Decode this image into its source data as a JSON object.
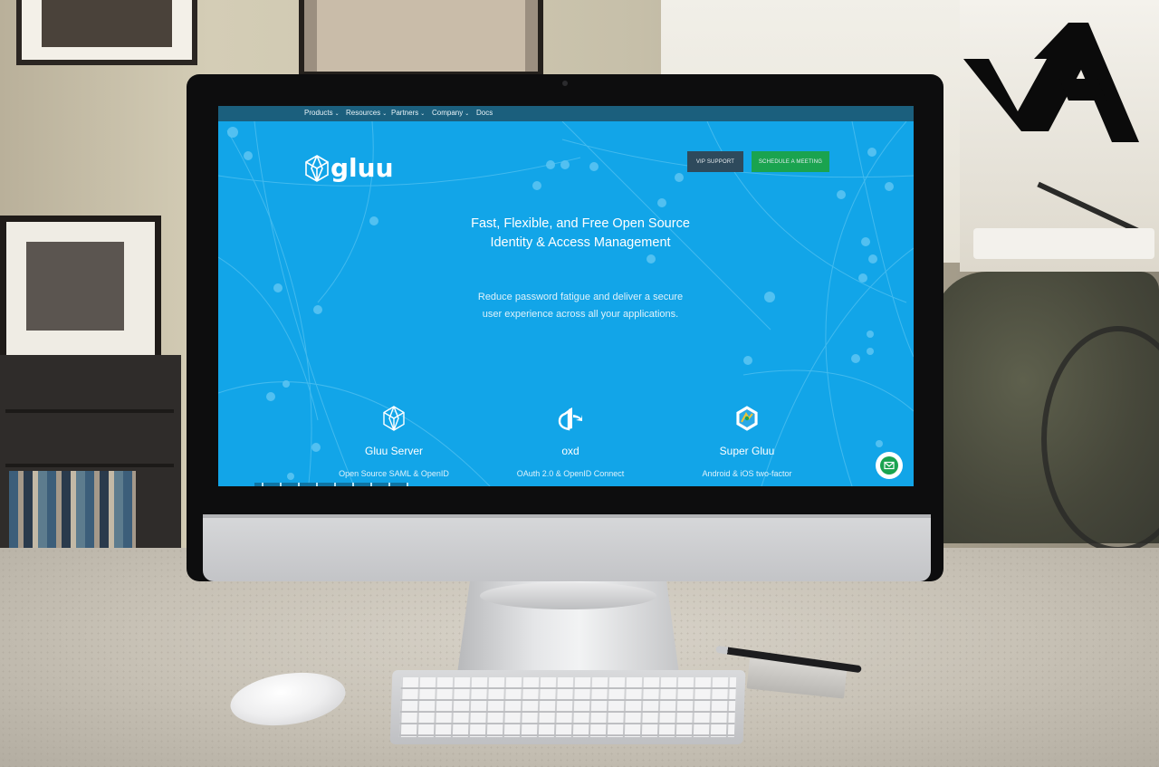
{
  "brand": {
    "mark_text": "vA"
  },
  "screen": {
    "nav": {
      "items": [
        {
          "label": "Products",
          "has_dropdown": true
        },
        {
          "label": "Resources",
          "has_dropdown": true
        },
        {
          "label": "Partners",
          "has_dropdown": true
        },
        {
          "label": "Company",
          "has_dropdown": true
        },
        {
          "label": "Docs",
          "has_dropdown": false
        }
      ],
      "chevron": "⌄"
    },
    "logo": {
      "text": "gluu",
      "icon": "gluu-polyhedron-icon"
    },
    "buttons": {
      "vip_support": "VIP SUPPORT",
      "schedule_meeting": "SCHEDULE A MEETING"
    },
    "hero": {
      "headline_line1": "Fast, Flexible, and Free Open Source",
      "headline_line2": "Identity & Access Management",
      "subline_line1": "Reduce password fatigue and deliver a secure",
      "subline_line2": "user experience across all your applications."
    },
    "features": [
      {
        "title": "Gluu Server",
        "desc": "Open Source SAML & OpenID",
        "icon": "polyhedron-icon"
      },
      {
        "title": "oxd",
        "desc": "OAuth 2.0 & OpenID Connect",
        "icon": "openid-logo-icon"
      },
      {
        "title": "Super Gluu",
        "desc": "Android & iOS two-factor",
        "icon": "super-gluu-badge-icon"
      }
    ],
    "chat": {
      "icon": "chat-envelope-icon"
    },
    "colors": {
      "hero_bg": "#12a5e8",
      "nav_bg": "#1b5f7d",
      "vip_bg": "#2e4a5c",
      "meeting_bg": "#1aa34f"
    }
  }
}
